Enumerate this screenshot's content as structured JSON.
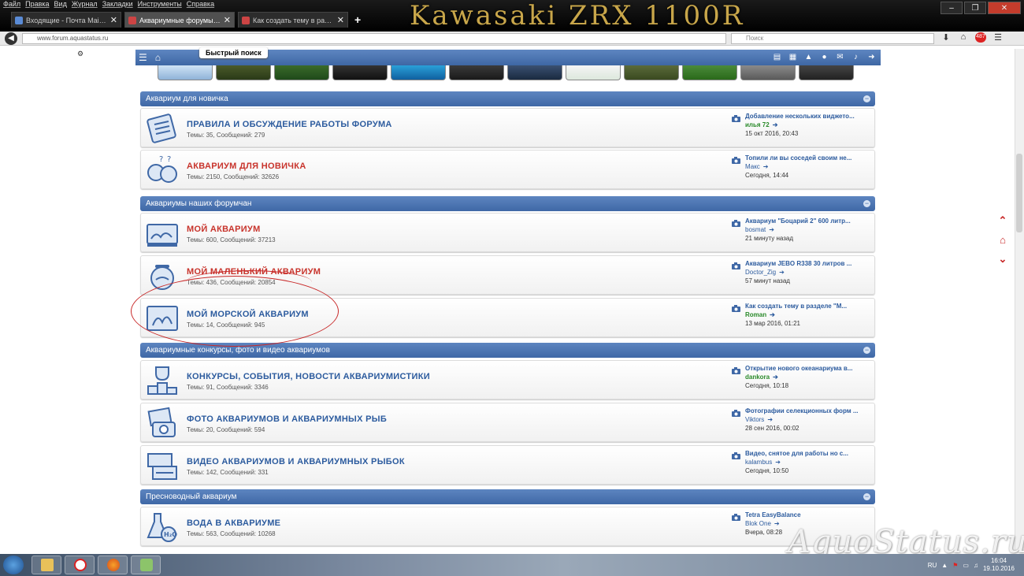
{
  "browser": {
    "menu": [
      "Файл",
      "Правка",
      "Вид",
      "Журнал",
      "Закладки",
      "Инструменты",
      "Справка"
    ],
    "banner_title": "Kawasaki ZRX 1100R",
    "tabs": [
      {
        "title": "Входящие - Почта Mail.Ru",
        "active": false
      },
      {
        "title": "Аквариумные форумы Аq...",
        "active": true
      },
      {
        "title": "Как создать тему в раздел...",
        "active": false
      }
    ],
    "new_tab": "+",
    "url": "www.forum.aquastatus.ru",
    "search_placeholder": "Поиск",
    "badge_count": "487"
  },
  "forum": {
    "quick_search": "Быстрый поиск",
    "categories": [
      {
        "title": "Аквариум для новичка",
        "collapse": "−"
      },
      {
        "title": "Аквариумы наших форумчан",
        "collapse": "−"
      },
      {
        "title": "Аквариумные конкурсы, фото и видео аквариумов",
        "collapse": "−"
      },
      {
        "title": "Пресноводный аквариум",
        "collapse": "−"
      }
    ],
    "forums": [
      {
        "name": "ПРАВИЛА И ОБСУЖДЕНИЕ РАБОТЫ ФОРУМА",
        "stats": "Темы: 35, Сообщений: 279",
        "last_title": "Добавление нескольких виджето...",
        "last_author": "илья 72",
        "last_date": "15 окт 2016, 20:43",
        "highlight": false,
        "author_green": true
      },
      {
        "name": "АКВАРИУМ ДЛЯ НОВИЧКА",
        "stats": "Темы: 2150, Сообщений: 32626",
        "last_title": "Топили ли вы соседей своим не...",
        "last_author": "Макс",
        "last_date": "Сегодня, 14:44",
        "highlight": true,
        "author_green": false
      },
      {
        "name": "МОЙ АКВАРИУМ",
        "stats": "Темы: 600, Сообщений: 37213",
        "last_title": "Аквариум \"Боцарий 2\" 600 литр...",
        "last_author": "bosmat",
        "last_date": "21 минуту назад",
        "highlight": true,
        "author_green": false
      },
      {
        "name": "МОЙ МАЛЕНЬКИЙ АКВАРИУМ",
        "stats": "Темы: 436, Сообщений: 20854",
        "last_title": "Аквариум JEBO R338 30 литров ...",
        "last_author": "Doctor_Zig",
        "last_date": "57 минут назад",
        "highlight": true,
        "author_green": false
      },
      {
        "name": "МОЙ МОРСКОЙ АКВАРИУМ",
        "stats": "Темы: 14, Сообщений: 945",
        "last_title": "Как создать тему в разделе \"М...",
        "last_author": "Roman",
        "last_date": "13 мар 2016, 01:21",
        "highlight": false,
        "author_green": true
      },
      {
        "name": "КОНКУРСЫ, СОБЫТИЯ, НОВОСТИ АКВАРИУМИСТИКИ",
        "stats": "Темы: 91, Сообщений: 3346",
        "last_title": "Открытие нового океанариума в...",
        "last_author": "dankora",
        "last_date": "Сегодня, 10:18",
        "highlight": false,
        "author_green": true
      },
      {
        "name": "ФОТО АКВАРИУМОВ И АКВАРИУМНЫХ РЫБ",
        "stats": "Темы: 20, Сообщений: 594",
        "last_title": "Фотографии селекционных форм ...",
        "last_author": "Viktors",
        "last_date": "28 сен 2016, 00:02",
        "highlight": false,
        "author_green": false
      },
      {
        "name": "ВИДЕО АКВАРИУМОВ И АКВАРИУМНЫХ РЫБОК",
        "stats": "Темы: 142, Сообщений: 331",
        "last_title": "Видео, снятое для работы но с...",
        "last_author": "kalambus",
        "last_date": "Сегодня, 10:50",
        "highlight": false,
        "author_green": false
      },
      {
        "name": "ВОДА В АКВАРИУМЕ",
        "stats": "Темы: 563, Сообщений: 10268",
        "last_title": "Tetra EasyBalance",
        "last_author": "Blok One",
        "last_date": "Вчера, 08:28",
        "highlight": false,
        "author_green": false
      }
    ],
    "watermark": "AquoStatus.ru"
  },
  "taskbar": {
    "lang": "RU",
    "time": "16:04",
    "date": "19.10.2016"
  },
  "colors": {
    "category_bar": "#4a73b0",
    "forum_link": "#2c5b9e",
    "forum_link_new": "#c8342c",
    "author_green": "#2a8a2a",
    "annotation": "#c82828"
  }
}
